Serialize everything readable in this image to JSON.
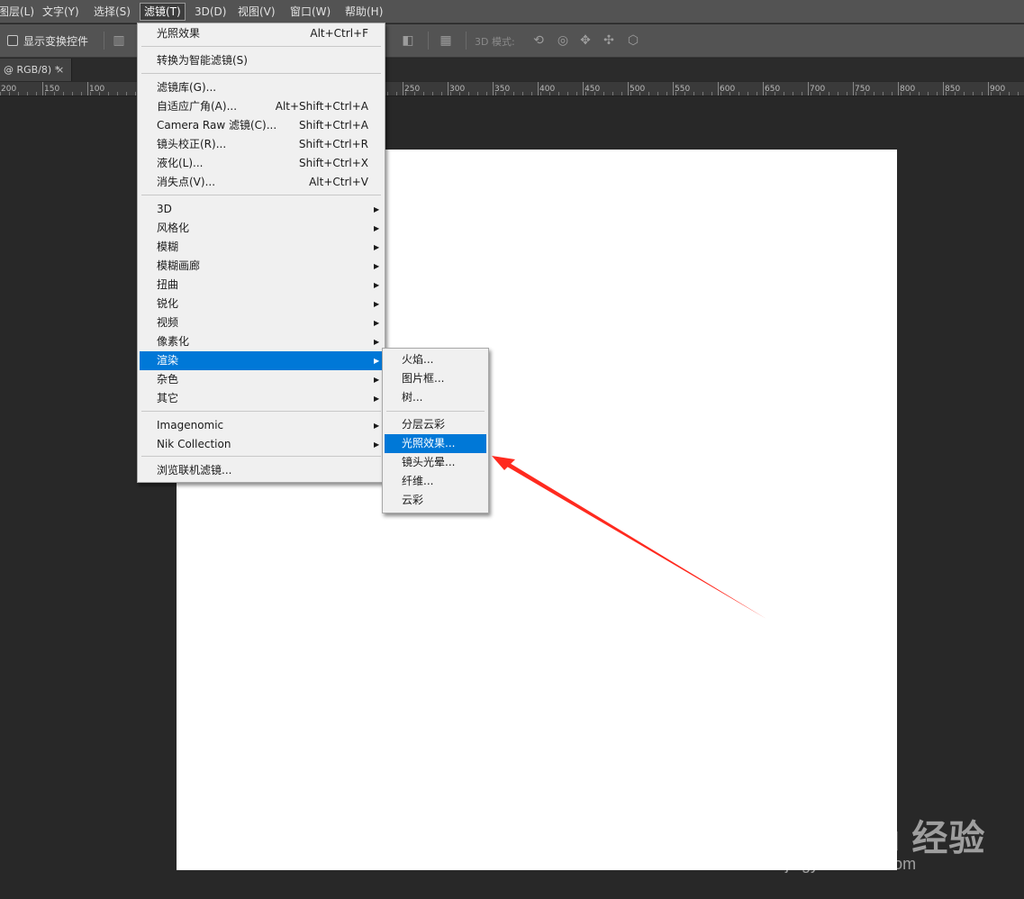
{
  "menubar": {
    "items": [
      "图层(L)",
      "文字(Y)",
      "选择(S)",
      "滤镜(T)",
      "3D(D)",
      "视图(V)",
      "窗口(W)",
      "帮助(H)"
    ]
  },
  "options_bar": {
    "show_transform_controls": "显示变换控件",
    "mode_label": "3D 模式:",
    "icons": [
      "align-top-icon",
      "align-vcenter-icon",
      "distribute-icon",
      "auto-align-icon",
      "rotate-3d-icon",
      "roll-3d-icon",
      "pan-3d-icon",
      "slide-3d-icon",
      "scale-3d-icon"
    ]
  },
  "document_tab": {
    "title": "@ RGB/8) *",
    "close": "×"
  },
  "ruler": {
    "labels": [
      "200",
      "150",
      "100",
      "250",
      "300",
      "350",
      "400",
      "450",
      "500",
      "550",
      "600",
      "650",
      "700",
      "750",
      "800",
      "850",
      "900"
    ]
  },
  "filter_menu": {
    "items": [
      {
        "label": "光照效果",
        "shortcut": "Alt+Ctrl+F"
      },
      {
        "label": "转换为智能滤镜(S)"
      },
      {
        "label": "滤镜库(G)..."
      },
      {
        "label": "自适应广角(A)...",
        "shortcut": "Alt+Shift+Ctrl+A"
      },
      {
        "label": "Camera Raw 滤镜(C)...",
        "shortcut": "Shift+Ctrl+A"
      },
      {
        "label": "镜头校正(R)...",
        "shortcut": "Shift+Ctrl+R"
      },
      {
        "label": "液化(L)...",
        "shortcut": "Shift+Ctrl+X"
      },
      {
        "label": "消失点(V)...",
        "shortcut": "Alt+Ctrl+V"
      },
      {
        "label": "3D",
        "submenu": true
      },
      {
        "label": "风格化",
        "submenu": true
      },
      {
        "label": "模糊",
        "submenu": true
      },
      {
        "label": "模糊画廊",
        "submenu": true
      },
      {
        "label": "扭曲",
        "submenu": true
      },
      {
        "label": "锐化",
        "submenu": true
      },
      {
        "label": "视频",
        "submenu": true
      },
      {
        "label": "像素化",
        "submenu": true
      },
      {
        "label": "渲染",
        "submenu": true,
        "highlighted": true
      },
      {
        "label": "杂色",
        "submenu": true
      },
      {
        "label": "其它",
        "submenu": true
      },
      {
        "label": "Imagenomic",
        "submenu": true
      },
      {
        "label": "Nik Collection",
        "submenu": true
      },
      {
        "label": "浏览联机滤镜..."
      }
    ]
  },
  "render_submenu": {
    "items": [
      {
        "label": "火焰..."
      },
      {
        "label": "图片框..."
      },
      {
        "label": "树..."
      },
      {
        "label": "分层云彩"
      },
      {
        "label": "光照效果...",
        "highlighted": true
      },
      {
        "label": "镜头光晕..."
      },
      {
        "label": "纤维..."
      },
      {
        "label": "云彩"
      }
    ]
  },
  "submenu_arrow": "▶",
  "watermark": {
    "brand": "Bai du 经验",
    "url": "jingyan.baidu.com"
  },
  "colors": {
    "highlight": "#0078d7",
    "annotation_arrow": "#ff2a1f",
    "workspace": "#282828",
    "menubar": "#535353"
  }
}
